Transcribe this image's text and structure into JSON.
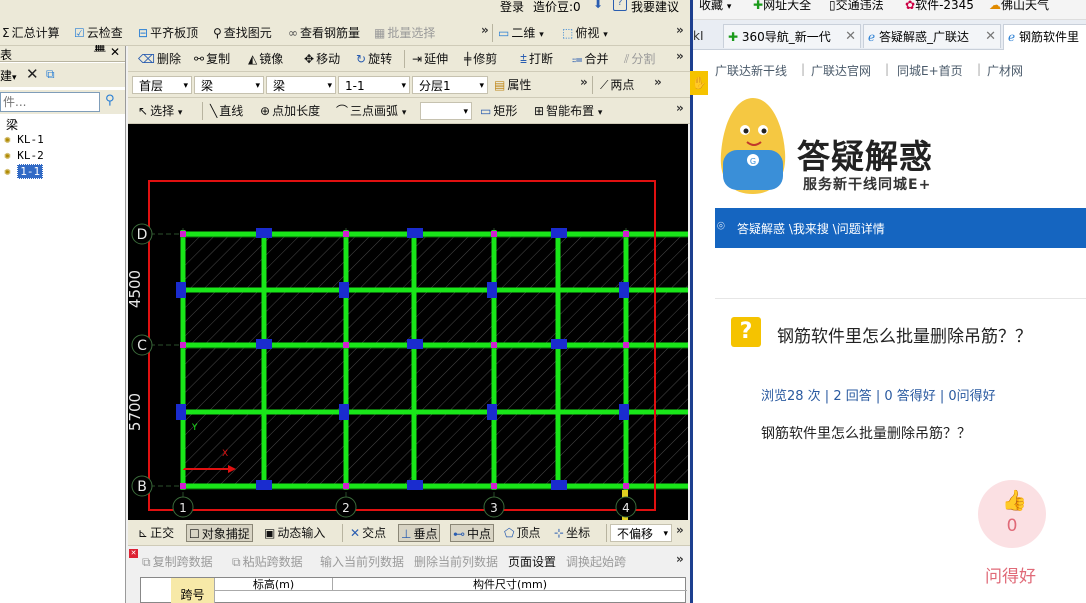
{
  "cad": {
    "top_menu": {
      "login": "登录",
      "price_label": "造价豆:0",
      "suggest": "我要建议"
    },
    "toolbar1": {
      "items": [
        "汇总计算",
        "云检查",
        "平齐板顶",
        "查找图元",
        "查看钢筋量",
        "批量选择"
      ],
      "view_mode": "二维",
      "view_dir": "俯视"
    },
    "toolbar2": {
      "items": [
        "删除",
        "复制",
        "镜像",
        "移动",
        "旋转",
        "延伸",
        "修剪",
        "打断",
        "合并",
        "分割"
      ]
    },
    "toolbar3": {
      "floor": "首层",
      "type": "梁",
      "subtype": "梁",
      "element": "1-1",
      "layer": "分层1",
      "property": "属性",
      "twopoint": "两点"
    },
    "toolbar4": {
      "select": "选择",
      "line": "直线",
      "point_len": "点加长度",
      "arc": "三点画弧",
      "rect": "矩形",
      "smart": "智能布置"
    },
    "sidebar": {
      "title": "表",
      "new_label": "建",
      "search_placeholder": "件...",
      "tree_root": "梁",
      "tree_items": [
        "KL-1",
        "KL-2",
        "1-1"
      ],
      "selected_index": 2
    },
    "grid": {
      "row_labels": [
        "D",
        "C",
        "B"
      ],
      "col_labels": [
        "1",
        "2",
        "3",
        "4"
      ],
      "dims": [
        "4500",
        "5700"
      ]
    },
    "snap_bar": {
      "items": [
        "正交",
        "对象捕捉",
        "动态输入",
        "交点",
        "垂点",
        "中点",
        "顶点",
        "坐标"
      ],
      "offset": "不偏移"
    },
    "bottom_bar": {
      "items": [
        "复制跨数据",
        "粘贴跨数据",
        "输入当前列数据",
        "删除当前列数据",
        "页面设置",
        "调换起始跨"
      ]
    },
    "table": {
      "col_span": "跨号",
      "col_elev": "标高(m)",
      "col_size": "构件尺寸(mm)"
    }
  },
  "browser": {
    "bookmarks": [
      "收藏",
      "网址大全",
      "交通违法",
      "软件-2345",
      "佛山天气"
    ],
    "tabs": [
      {
        "title": "360导航_新一代"
      },
      {
        "title": "答疑解惑_广联达"
      },
      {
        "title": "钢筋软件里"
      }
    ],
    "nav_links": [
      "广联达新干线",
      "广联达官网",
      "同城E+首页",
      "广材网"
    ],
    "logo_title": "答疑解惑",
    "logo_subtitle": "服务新干线同城E+",
    "breadcrumb": "答疑解惑 \\我来搜 \\问题详情",
    "question_title": "钢筋软件里怎么批量删除吊筋？？",
    "stats": "浏览28 次 | 2 回答 | 0 答得好 | 0问得好",
    "question_body": "钢筋软件里怎么批量删除吊筋？？",
    "like_count": "0",
    "like_label": "问得好",
    "accent": "#1565c0",
    "like_color": "#e06a78"
  }
}
